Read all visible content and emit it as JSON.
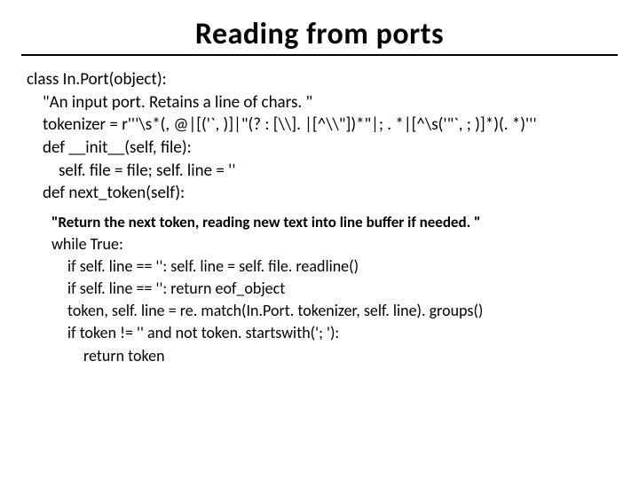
{
  "title": "Reading from ports",
  "code": {
    "l1": "class In.Port(object):",
    "l2": "\"An input port. Retains a line of chars. \"",
    "l3": "tokenizer = r'''\\s*(, @|[('`, )]|\"(? : [\\\\]. |[^\\\\\"])*\"|; . *|[^\\s('\"`, ; )]*)(. *)'''",
    "l4": "def __init__(self, file):",
    "l5": "self. file = file; self. line = ''",
    "l6": "def next_token(self):"
  },
  "inner": {
    "doc": "\"Return the next token, reading new text into line buffer if needed. \"",
    "w1": "while True:",
    "w2": "if self. line == '': self. line = self. file. readline()",
    "w3": "if self. line == '': return eof_object",
    "w4": "token, self. line = re. match(In.Port. tokenizer, self. line). groups()",
    "w5": "if token != '' and not token. startswith('; '):",
    "w6": "return token"
  }
}
